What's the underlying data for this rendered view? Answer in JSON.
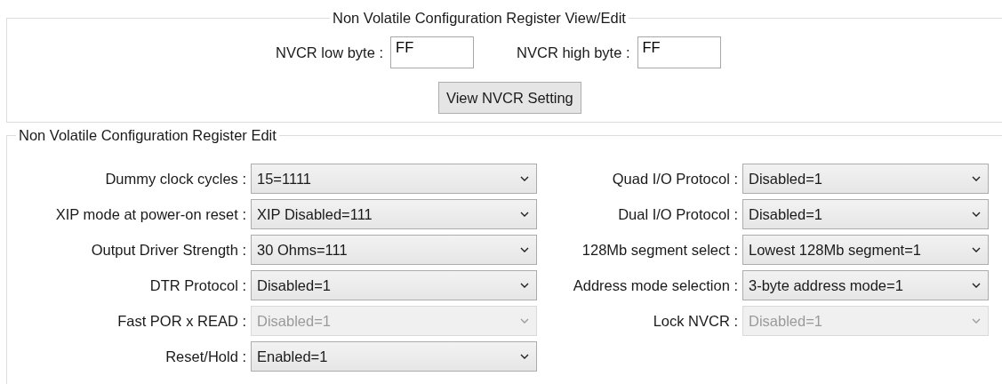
{
  "view_group": {
    "title": "Non Volatile Configuration Register View/Edit",
    "fields": [
      {
        "label": "NVCR low byte :",
        "value": "FF"
      },
      {
        "label": "NVCR high byte :",
        "value": "FF"
      }
    ],
    "button": "View NVCR Setting"
  },
  "edit_group": {
    "title": "Non Volatile Configuration Register Edit",
    "left": [
      {
        "label": "Dummy clock cycles :",
        "value": "15=1111",
        "disabled": false
      },
      {
        "label": "XIP mode at power-on reset :",
        "value": "XIP Disabled=111",
        "disabled": false
      },
      {
        "label": "Output Driver Strength :",
        "value": "30 Ohms=111",
        "disabled": false
      },
      {
        "label": "DTR Protocol :",
        "value": "Disabled=1",
        "disabled": false
      },
      {
        "label": "Fast POR x READ :",
        "value": "Disabled=1",
        "disabled": true
      },
      {
        "label": "Reset/Hold :",
        "value": "Enabled=1",
        "disabled": false
      }
    ],
    "right": [
      {
        "label": "Quad I/O Protocol :",
        "value": "Disabled=1",
        "disabled": false
      },
      {
        "label": "Dual I/O Protocol :",
        "value": "Disabled=1",
        "disabled": false
      },
      {
        "label": "128Mb segment select :",
        "value": "Lowest 128Mb segment=1",
        "disabled": false
      },
      {
        "label": "Address mode selection :",
        "value": "3-byte address mode=1",
        "disabled": false
      },
      {
        "label": "Lock NVCR :",
        "value": "Disabled=1",
        "disabled": true
      }
    ]
  }
}
